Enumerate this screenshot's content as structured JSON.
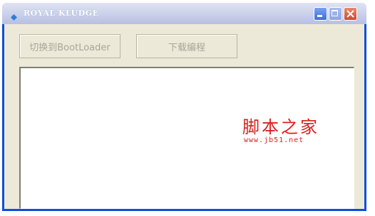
{
  "window": {
    "title": "ROYAL KLUDGE"
  },
  "buttons": {
    "bootloader_label": "切换到BootLoader",
    "download_label": "下载编程"
  },
  "log": {
    "value": ""
  },
  "watermark": {
    "title": "脚本之家",
    "url": "www.jb51.net"
  },
  "colors": {
    "titlebar": "#cdd3eb",
    "client_bg": "#ece9d8",
    "watermark": "#d9211d"
  },
  "icons": {
    "app": "app-diamond-icon",
    "minimize": "minimize-icon",
    "maximize": "maximize-icon",
    "close": "close-icon"
  }
}
